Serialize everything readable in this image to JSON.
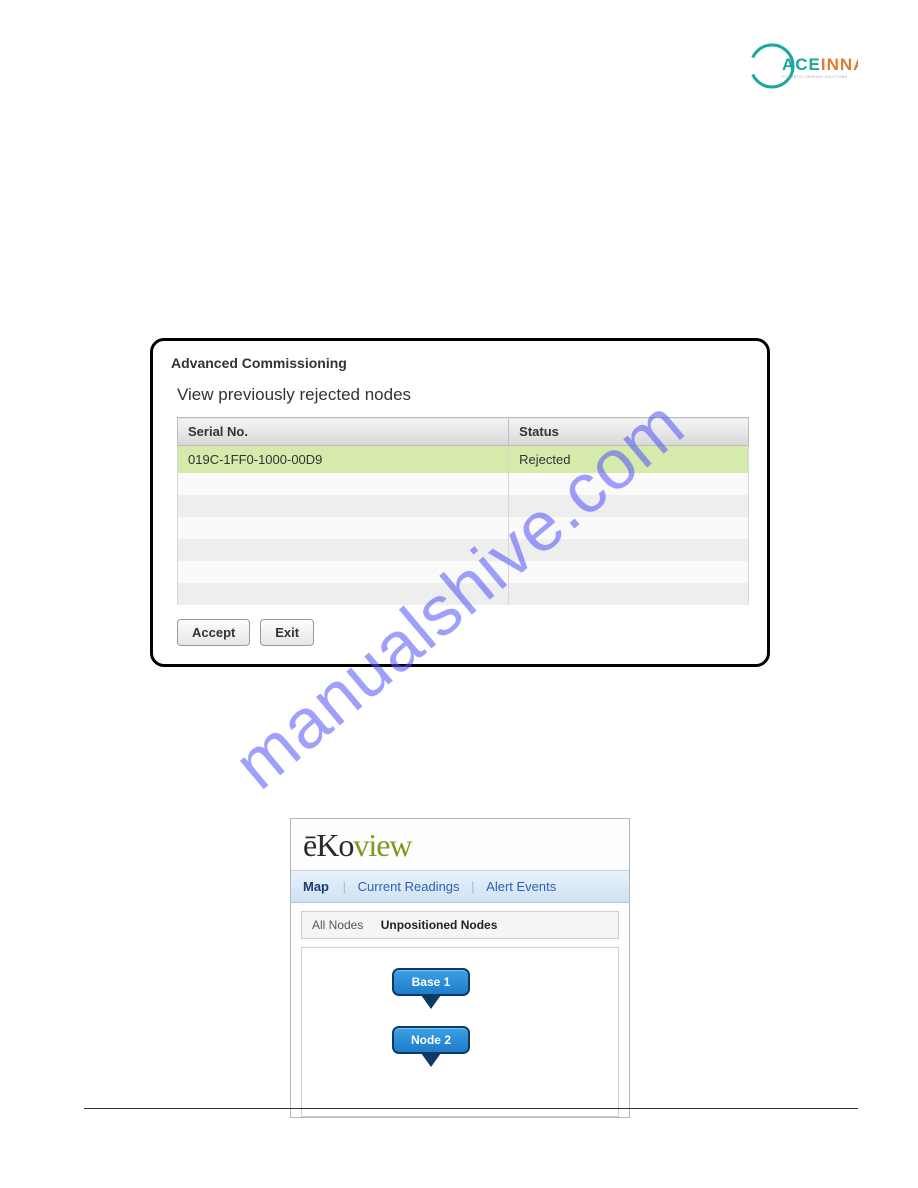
{
  "logo": {
    "brand_left": "ACE",
    "brand_right": "INNA"
  },
  "watermark": "manualshive.com",
  "dialog": {
    "title": "Advanced Commissioning",
    "subtitle": "View previously rejected nodes",
    "columns": {
      "serial": "Serial No.",
      "status": "Status"
    },
    "row": {
      "serial": "019C-1FF0-1000-00D9",
      "status": "Rejected"
    },
    "buttons": {
      "accept": "Accept",
      "exit": "Exit"
    }
  },
  "ekoview": {
    "logo": {
      "ek": "ēKo",
      "ov": "view"
    },
    "tabs": {
      "map": "Map",
      "current": "Current Readings",
      "alerts": "Alert Events"
    },
    "subtabs": {
      "all": "All Nodes",
      "unpos": "Unpositioned Nodes"
    },
    "nodes": {
      "base1": "Base 1",
      "node2": "Node 2"
    }
  }
}
